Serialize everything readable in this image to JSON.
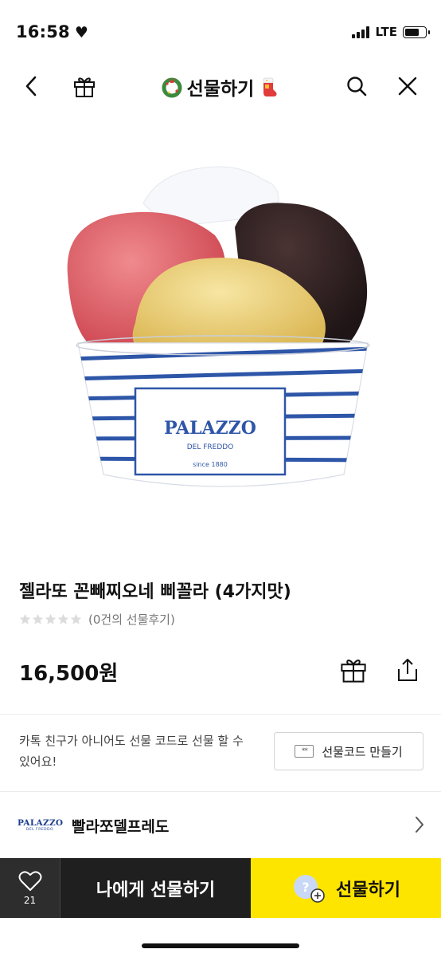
{
  "status_bar": {
    "time": "16:58",
    "network": "LTE",
    "battery_level": 0.7
  },
  "nav": {
    "title": "선물하기",
    "icons": [
      "back-chevron-icon",
      "gift-box-icon",
      "wreath-icon",
      "gift-sock-icon",
      "search-icon",
      "close-icon"
    ]
  },
  "product": {
    "title": "젤라또 꼰빼찌오네 삐꼴라 (4가지맛)",
    "review_count_text": "(0건의 선물후기)",
    "rating": 0,
    "rating_max": 5,
    "price": "16,500원",
    "image": {
      "brand": "PALAZZO",
      "sub_brand": "DEL FREDDO",
      "since": "since 1880"
    }
  },
  "gift_code": {
    "description": "카톡 친구가 아니어도 선물 코드로 선물 할 수 있어요!",
    "button_label": "선물코드 만들기",
    "button_icon_text": "**"
  },
  "brand": {
    "logo_text": "PALAZZO",
    "logo_sub": "DEL FREDDO",
    "name": "빨라쪼델프레도"
  },
  "bottom_bar": {
    "wish_count": "21",
    "gift_self_label": "나에게 선물하기",
    "gift_friend_label": "선물하기",
    "friend_icon_text": "?"
  },
  "colors": {
    "accent_yellow": "#fee500",
    "dark_button": "#1f1f1f",
    "brand_blue": "#1e3f8f"
  }
}
